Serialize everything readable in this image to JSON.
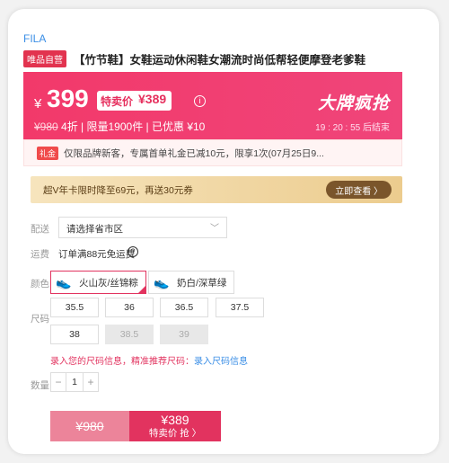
{
  "brand": "FILA",
  "product": {
    "tag": "唯品自营",
    "title": "【竹节鞋】女鞋运动休闲鞋女潮流时尚低帮轻便摩登老爹鞋"
  },
  "price_banner": {
    "currency": "¥",
    "price": "399",
    "special_label": "特卖价",
    "special_price": "¥389",
    "info_icon": "ⓘ",
    "original_price": "¥980",
    "discount_line": "4折 | 限量1900件 | 已优惠 ¥10",
    "promo_title": "大牌疯抢",
    "countdown": "19 : 20 : 55  后结束",
    "colors": {
      "bg": "#f03d6f",
      "accent": "#e6305e"
    }
  },
  "gift": {
    "tag": "礼金",
    "text": "仅限品牌新客，专属首单礼金已减10元，限享1次(07月25日9..."
  },
  "vip_card": {
    "text": "超V年卡限时降至69元，再送30元券",
    "button": "立即查看 〉"
  },
  "delivery": {
    "label": "配送",
    "select_value": "请选择省市区",
    "chevron": "﹀"
  },
  "shipping": {
    "label": "运费",
    "text": "订单满88元免运费",
    "help_icon": "?"
  },
  "color": {
    "label": "颜色",
    "options": [
      {
        "name": "火山灰/丝锦粽",
        "selected": true
      },
      {
        "name": "奶白/深草绿",
        "selected": false
      }
    ]
  },
  "size": {
    "label": "尺码",
    "options": [
      {
        "value": "35.5",
        "disabled": false
      },
      {
        "value": "36",
        "disabled": false
      },
      {
        "value": "36.5",
        "disabled": false
      },
      {
        "value": "37.5",
        "disabled": false
      },
      {
        "value": "38",
        "disabled": false
      },
      {
        "value": "38.5",
        "disabled": true
      },
      {
        "value": "39",
        "disabled": true
      }
    ],
    "hint_text": "录入您的尺码信息，精准推荐尺码：",
    "hint_link": "录入尺码信息"
  },
  "quantity": {
    "label": "数量",
    "value": "1",
    "minus": "−",
    "plus": "+"
  },
  "buy": {
    "left_price": "¥980",
    "right_price": "¥389",
    "right_label": "特卖价 抢 〉"
  }
}
